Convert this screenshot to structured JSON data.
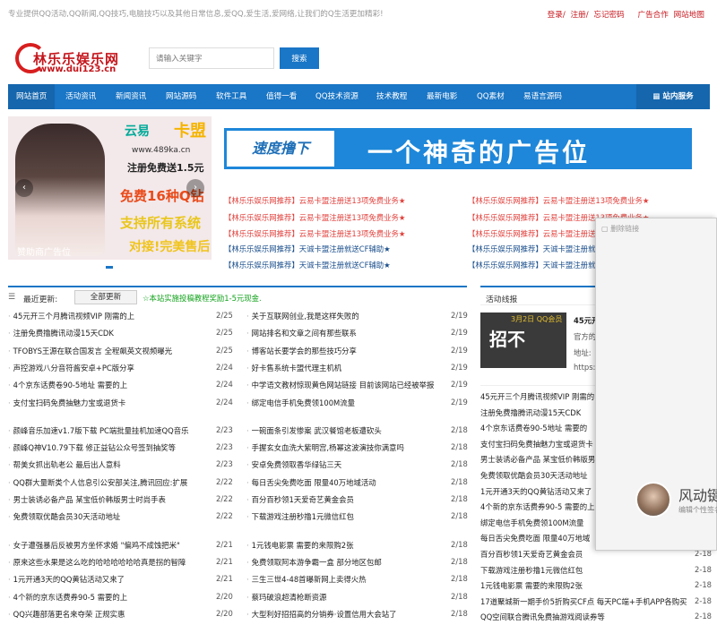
{
  "topbar": {
    "slogan": "专业提供QQ活动,QQ新闻,QQ技巧,电脑技巧以及其他日常信息,爱QQ,爱生活,爱网络,让我们的Q生活更加精彩!",
    "login": "登录",
    "register": "注册",
    "forgot": "忘记密码",
    "ads": "广告合作",
    "sitemap": "网站地图"
  },
  "header": {
    "logo_name": "林乐乐娱乐网",
    "logo_url": "www.dui123.cn",
    "search_placeholder": "请输入关键字",
    "search_button": "搜索"
  },
  "nav": {
    "items": [
      "网站首页",
      "活动资讯",
      "新闻资讯",
      "网站源码",
      "软件工具",
      "值得一看",
      "QQ技术资源",
      "技术教程",
      "最新电影",
      "QQ素材",
      "易语言源码"
    ],
    "right": "站内服务"
  },
  "slider": {
    "brand": "云易",
    "brand2": "卡盟",
    "site": "www.489ka.cn",
    "line1": "注册免费送1.5元",
    "line2": "免费16种Q钻",
    "line3": "支持所有系统",
    "line4": "对接!完美售后",
    "caption": "赞助商广告位",
    "prev": "‹",
    "next": "›"
  },
  "banner": {
    "left": "速度撸下",
    "right": "一个神奇的广告位"
  },
  "promos": {
    "red": "【林乐乐娱乐网推荐】云易卡盟注册送13项免费业务★",
    "blue": "【林乐乐娱乐网推荐】天诚卡盟注册就送CF辅助★"
  },
  "float_panel": {
    "top": "▢ 删除链接",
    "title": "风动键",
    "sub": "编辑个性签名"
  },
  "latest": {
    "label": "最近更新:",
    "tab": "全部更新",
    "notice": "☆本站实施投稿教程奖励1-5元现金."
  },
  "left_list": [
    {
      "t": "45元开三个月腾讯视频VIP 刚需的上",
      "d": "2/25"
    },
    {
      "t": "注册免费撸腾讯动漫15天CDK",
      "d": "2/25"
    },
    {
      "t": "TFOBYS王源在联合国发言 全程飙英文视频曝光",
      "d": "2/25"
    },
    {
      "t": "声控游戏八分音符酱安卓+PC版分享",
      "d": "2/24"
    },
    {
      "t": "4个京东话费卷90-5地址 需要的上",
      "d": "2/24"
    },
    {
      "t": "支付宝扫码免费抽魅力宝或退货卡",
      "d": "2/24"
    },
    {
      "t": "颜峰音乐加速v1.7版下载 PC端批量挂机加速QQ音乐",
      "d": "2/23"
    },
    {
      "t": "颜峰Q神V10.79下载 修正益钻公众号签到抽奖等",
      "d": "2/23"
    },
    {
      "t": "帮美女抓出轨老公 最后出人意料",
      "d": "2/23"
    },
    {
      "t": "QQ群大量断类个人信息引公安部关注,腾讯回应:扩展",
      "d": "2/22"
    },
    {
      "t": "男士装诱必备产品 某宝低价韩版男士时尚手表",
      "d": "2/22"
    },
    {
      "t": "免费领取优酷会员30天活动地址",
      "d": "2/22"
    },
    {
      "t": "女子遭强暴后反被男方坐怀求婚 \"偏鸡不成蚀把米\"",
      "d": "2/21"
    },
    {
      "t": "原来这些水果是这么吃的哈哈哈哈哈哈真是拐的智障",
      "d": "2/21"
    },
    {
      "t": "1元开通3天的QQ黄钻活动又来了",
      "d": "2/21"
    },
    {
      "t": "4个新的京东话费券90-5 需要的上",
      "d": "2/20"
    },
    {
      "t": "QQ兴趣部落更名来夺荣 正规实惠",
      "d": "2/20"
    }
  ],
  "mid_list": [
    {
      "t": "关于互联网创业,我是这样失败的",
      "d": "2/19"
    },
    {
      "t": "网站排名和文章之间有那些联系",
      "d": "2/19"
    },
    {
      "t": "博客站长要学会的那些技巧分享",
      "d": "2/19"
    },
    {
      "t": "好卡售系统卡盟代理主机机",
      "d": "2/19"
    },
    {
      "t": "中学语文教材惊现黄色网站链接 目前该网站已经被举报",
      "d": "2/19"
    },
    {
      "t": "绑定电信手机免费领100M流量",
      "d": "2/19"
    },
    {
      "t": "一碗面条引发惨案 武汉餐馆老板遭砍头",
      "d": "2/18"
    },
    {
      "t": "手握玄女血洗大紫明宫,杨幂这波演技你满意吗",
      "d": "2/18"
    },
    {
      "t": "安卓免费领取香华绿钻三天",
      "d": "2/18"
    },
    {
      "t": "每日舌尖免费吃面 限量40万地域活动",
      "d": "2/18"
    },
    {
      "t": "百分百秒领1天爱奇艺黄金会员",
      "d": "2/18"
    },
    {
      "t": "下载游戏注册秒撸1元微信红包",
      "d": "2/18"
    },
    {
      "t": "1元钱电影票 需要的来限购2张",
      "d": "2/18"
    },
    {
      "t": "免费领取阿本游争霸一盒 部分地区包邮",
      "d": "2/18"
    },
    {
      "t": "三生三世4-48首曝新网上卖得火热",
      "d": "2/18"
    },
    {
      "t": "蔡玛破浪超清枪断资源",
      "d": "2/18"
    },
    {
      "t": "大型利好招招高的分销券·设置信用大会站了",
      "d": "2/18"
    }
  ],
  "side": {
    "label": "活动线报",
    "thumb_big": "招不",
    "thumb_small": "3月2日 QQ会员",
    "thumb_title": "45元开三",
    "thumb_desc": "官方的",
    "thumb_addr": "地址:",
    "thumb_link": "https://",
    "items": [
      {
        "t": "45元开三个月腾讯视频VIP 刚需的",
        "d": ""
      },
      {
        "t": "注册免费撸腾讯动漫15天CDK",
        "d": ""
      },
      {
        "t": "4个京东话费卷90-5地址 需要的",
        "d": ""
      },
      {
        "t": "支付宝扫码免费抽魅力宝或退货卡",
        "d": ""
      },
      {
        "t": "男士装诱必备产品 某宝低价韩版男",
        "d": ""
      },
      {
        "t": "免费领取优酷会员30天活动地址",
        "d": ""
      },
      {
        "t": "1元开通3天的QQ黄钻活动又来了",
        "d": ""
      },
      {
        "t": "4个新的京东话费券90-5 需要的上",
        "d": ""
      },
      {
        "t": "绑定电信手机免费领100M流量",
        "d": ""
      },
      {
        "t": "每日舌尖免费吃面 限量40万地域",
        "d": ""
      },
      {
        "t": "百分百秒领1天爱奇艺黄金会员",
        "d": "2-18"
      },
      {
        "t": "下载游戏注册秒撸1元微信红包",
        "d": "2-18"
      },
      {
        "t": "1元钱电影票 需要的来限购2张",
        "d": "2-18"
      },
      {
        "t": "17道聚城新一期手价5折购买CF点 每天PC端+手机APP各购买",
        "d": "2-18"
      },
      {
        "t": "QQ空间联合腾讯免费抽游戏阅读券等",
        "d": "2-18"
      }
    ]
  },
  "colors": {
    "nav_blue": "#1a76c6",
    "promo_red": "#e0413c",
    "promo_blue": "#1b4f8c",
    "brand_red": "#c4161c"
  }
}
